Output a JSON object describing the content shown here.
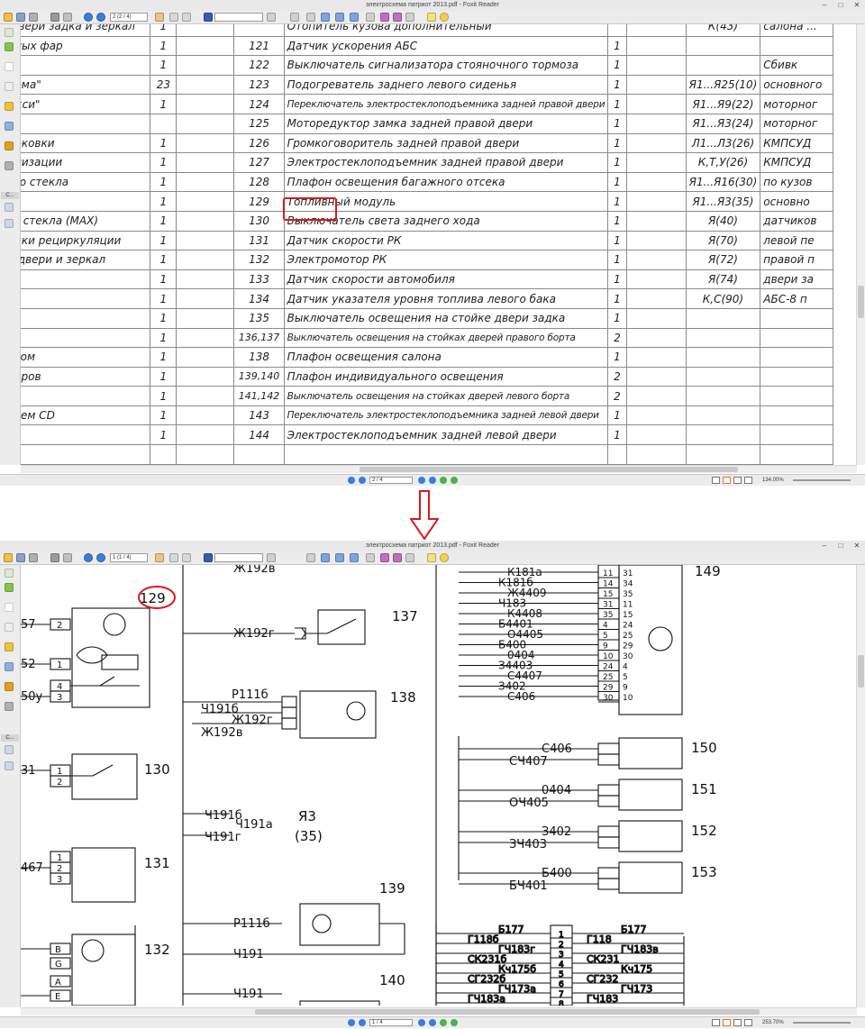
{
  "top_window": {
    "title": "электросхема патриот 2013.pdf - Foxit Reader",
    "page_field": "2 (2 / 4)",
    "nav_page": "2 / 4",
    "zoom": "134.00%",
    "sidebar_tab_label": "C...",
    "table": {
      "rows": [
        {
          "name": "а двери задка и зеркал",
          "qty": "1",
          "num": "",
          "component": "Отопитель кузова дополнительный",
          "cnt": "",
          "loc": "К(43)",
          "extra": "салона ..."
        },
        {
          "name": "анных фар",
          "qty": "1",
          "num": "121",
          "component": "Датчик ускорения АБС",
          "cnt": "1",
          "loc": "",
          "extra": ""
        },
        {
          "name": "",
          "qty": "1",
          "num": "122",
          "component": "Выключатель сигнализатора стояночного тормоза",
          "cnt": "1",
          "loc": "",
          "extra": "Сбивк"
        },
        {
          "name": "норма\"",
          "qty": "23",
          "num": "123",
          "component": "Подогреватель заднего левого сиденья",
          "cnt": "1",
          "loc": "Я1...Я25(10)",
          "extra": "основного"
        },
        {
          "name": "макси\"",
          "qty": "1",
          "num": "124",
          "component": "Переключатель электростеклоподъемника задней правой двери",
          "cnt": "1",
          "loc": "Я1...Я9(22)",
          "extra": "моторног"
        },
        {
          "name": "",
          "qty": "",
          "num": "125",
          "component": "Моторедуктор замка задней правой двери",
          "cnt": "1",
          "loc": "Я1...Я3(24)",
          "extra": "моторног"
        },
        {
          "name": "парковки",
          "qty": "1",
          "num": "126",
          "component": "Громкоговоритель задней правой двери",
          "cnt": "1",
          "loc": "Л1...Л3(26)",
          "extra": "КМПСУД"
        },
        {
          "name": "нализации",
          "qty": "1",
          "num": "127",
          "component": "Электростеклоподъемник задней правой двери",
          "cnt": "1",
          "loc": "К,Т,У(26)",
          "extra": "КМПСУД"
        },
        {
          "name": "вого стекла",
          "qty": "1",
          "num": "128",
          "component": "Плафон освещения багажного отсека",
          "cnt": "1",
          "loc": "Я1...Я16(30)",
          "extra": "по кузов"
        },
        {
          "name": "",
          "qty": "1",
          "num": "129",
          "component": "Топливный модуль",
          "cnt": "1",
          "loc": "Я1...Я3(35)",
          "extra": "основно"
        },
        {
          "name": "ого стекла (MAX)",
          "qty": "1",
          "num": "130",
          "component": "Выключатель света заднего хода",
          "cnt": "1",
          "loc": "Я(40)",
          "extra": "датчиков"
        },
        {
          "name": "лонки рециркуляции",
          "qty": "1",
          "num": "131",
          "component": "Датчик скорости РК",
          "cnt": "1",
          "loc": "Я(70)",
          "extra": "левой пе"
        },
        {
          "name": "ла двери и зеркал",
          "qty": "1",
          "num": "132",
          "component": "Электромотор РК",
          "cnt": "1",
          "loc": "Я(72)",
          "extra": "правой п"
        },
        {
          "name": "",
          "qty": "1",
          "num": "133",
          "component": "Датчик скорости автомобиля",
          "cnt": "1",
          "loc": "Я(74)",
          "extra": "двери за"
        },
        {
          "name": "а",
          "qty": "1",
          "num": "134",
          "component": "Датчик указателя уровня топлива левого бака",
          "cnt": "1",
          "loc": "К,С(90)",
          "extra": "АБС-8 п"
        },
        {
          "name": "",
          "qty": "1",
          "num": "135",
          "component": "Выключатель освещения на стойке двери задка",
          "cnt": "1",
          "loc": "",
          "extra": ""
        },
        {
          "name": "",
          "qty": "1",
          "num": "136,137",
          "component": "Выключатель освещения на стойках дверей правого борта",
          "cnt": "2",
          "loc": "",
          "extra": ""
        },
        {
          "name": "кетом",
          "qty": "1",
          "num": "138",
          "component": "Плафон освещения салона",
          "cnt": "1",
          "loc": "",
          "extra": ""
        },
        {
          "name": "иборов",
          "qty": "1",
          "num": "139,140",
          "component": "Плафон индивидуального освещения",
          "cnt": "2",
          "loc": "",
          "extra": ""
        },
        {
          "name": "",
          "qty": "1",
          "num": "141,142",
          "component": "Выключатель освещения на стойках дверей левого борта",
          "cnt": "2",
          "loc": "",
          "extra": ""
        },
        {
          "name": "телем CD",
          "qty": "1",
          "num": "143",
          "component": "Переключатель электростеклоподъемника задней левой двери",
          "cnt": "1",
          "loc": "",
          "extra": ""
        },
        {
          "name": "",
          "qty": "1",
          "num": "144",
          "component": "Электростеклоподъемник задней левой двери",
          "cnt": "1",
          "loc": "",
          "extra": ""
        },
        {
          "name": "",
          "qty": "",
          "num": "",
          "component": "",
          "cnt": "",
          "loc": "",
          "extra": ""
        }
      ]
    }
  },
  "bottom_window": {
    "title": "электросхема патриот 2013.pdf - Foxit Reader",
    "page_field": "1 (1 / 4)",
    "nav_page": "1 / 4",
    "zoom": "253.70%",
    "sidebar_tab_label": "C...",
    "schematic": {
      "labels": {
        "c129": "129",
        "c130": "130",
        "c131": "131",
        "c132": "132",
        "c137": "137",
        "c138": "138",
        "c139": "139",
        "c140": "140",
        "c149": "149",
        "c150": "150",
        "c151": "151",
        "c152": "152",
        "c153": "153",
        "ya3": "Я3",
        "ya3n": "(35)",
        "w_zh192v_top": "Ж192в",
        "w_zh192g": "Ж192г",
        "w_r111b": "Р111б",
        "w_ch191b": "Ч191б",
        "w_zh192g2": "Ж192г",
        "w_zh192v": "Ж192в",
        "w_ch191b2": "Ч191б",
        "w_ch191a": "Ч191а",
        "w_ch191g": "Ч191г",
        "w_r111b2": "Р111б",
        "w_ch191": "Ч191",
        "w_ch191_2": "Ч191",
        "w_57": "57",
        "w_52": "52",
        "w_50u": "50у",
        "w_31": "31",
        "w_467": "467",
        "pin_2a": "2",
        "pin_1a": "1",
        "pin_4a": "4",
        "pin_3a": "3",
        "pin_1b": "1",
        "pin_2b": "2",
        "pin_1c": "1",
        "pin_2c": "2",
        "pin_3c": "3",
        "pin_B": "B",
        "pin_G": "G",
        "pin_A": "A",
        "pin_E": "E",
        "k181a": "К181а",
        "k181b": "К181б",
        "zh4409": "Ж4409",
        "ch183": "Ч183",
        "k4408": "К4408",
        "b4401": "Б4401",
        "o4405": "О4405",
        "b4400": "Б400",
        "o404": "0404",
        "z4403": "З4403",
        "s4407": "С4407",
        "z402": "З402",
        "s406": "С406",
        "p149": [
          "11",
          "14",
          "15",
          "31",
          "35",
          "4",
          "5",
          "9",
          "10",
          "24",
          "25",
          "29",
          "30"
        ],
        "p149r": [
          "31",
          "34",
          "35",
          "11",
          "15",
          "24",
          "25",
          "29",
          "30",
          "4",
          "5",
          "9",
          "10"
        ],
        "s406b": "С406",
        "s4407b": "СЧ407",
        "o404b": "0404",
        "o4405b": "ОЧ405",
        "z402b": "З402",
        "z4403b": "ЗЧ403",
        "b400b": "Б400",
        "b4401b": "БЧ401",
        "g118b": "Г118б",
        "sk231b": "СК231б",
        "sg232b": "СГ232б",
        "g4183g": "ГЧ183г",
        "kch175b": "Кч175б",
        "g4173a": "ГЧ173а",
        "b177": "Б177",
        "g118": "Г118",
        "sk231": "СК231",
        "sg232": "СГ232",
        "g4183": "ГЧ183",
        "g4183v": "ГЧ183в",
        "kch175": "Кч175",
        "g4173": "ГЧ173",
        "b177r": "Б177",
        "g4183a": "ГЧ183а",
        "cp": [
          "1",
          "2",
          "3",
          "4",
          "5",
          "6",
          "7",
          "8"
        ]
      }
    }
  },
  "colors": {
    "annotation": "#d9191c",
    "toolbar_bg": "#ececec",
    "nav_blue": "#3b7dd8"
  }
}
